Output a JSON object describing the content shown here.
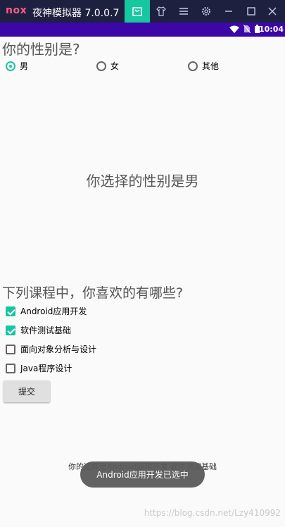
{
  "window": {
    "logo": "nox",
    "title": "夜神模拟器 7.0.0.7",
    "buttons": [
      "bag-icon",
      "shirt-icon",
      "menu-icon",
      "gear-icon",
      "minimize-icon",
      "maximize-icon",
      "close-icon"
    ]
  },
  "statusbar": {
    "time": "10:04"
  },
  "gender": {
    "question": "你的性别是?",
    "options": [
      {
        "label": "男",
        "selected": true
      },
      {
        "label": "女",
        "selected": false
      },
      {
        "label": "其他",
        "selected": false
      }
    ],
    "result": "你选择的性别是男"
  },
  "courses": {
    "question": "下列课程中，你喜欢的有哪些?",
    "options": [
      {
        "label": "Android应用开发",
        "checked": true
      },
      {
        "label": "软件测试基础",
        "checked": true
      },
      {
        "label": "面向对象分析与设计",
        "checked": false
      },
      {
        "label": "Java程序设计",
        "checked": false
      }
    ],
    "submit_label": "提交",
    "result": "你的选择是Android应用开发 软件测试基础"
  },
  "toast": "Android应用开发已选中",
  "watermark": "https://blog.csdn.net/Lzy410992"
}
